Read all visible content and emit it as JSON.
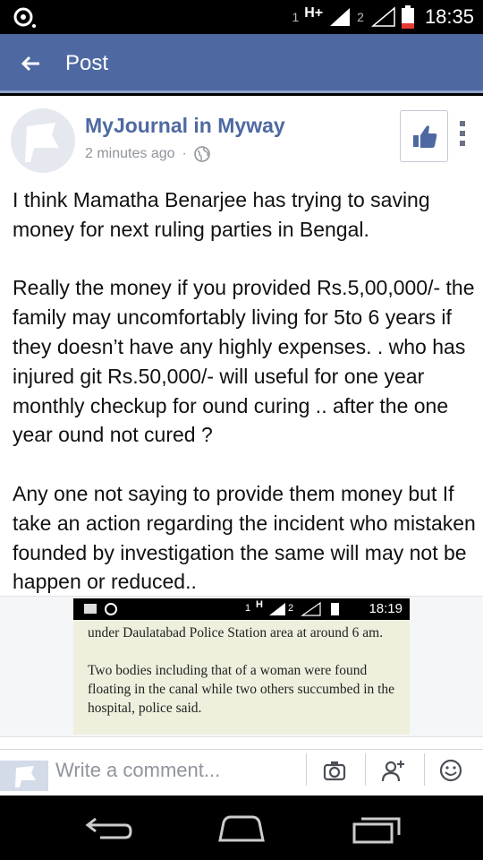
{
  "status_bar": {
    "sim1": "1",
    "network_type": "H+",
    "sim2": "2",
    "time": "18:35"
  },
  "app_bar": {
    "title": "Post"
  },
  "post": {
    "author": "MyJournal in Myway",
    "timestamp": "2 minutes ago",
    "separator": "·",
    "privacy_icon": "globe-icon",
    "paragraphs": [
      "I think Mamatha Benarjee has trying to saving money for next ruling parties in Bengal.",
      "Really the money if you provided Rs.5,00,000/- the family may uncomfortably living for 5to 6 years if they doesn’t have any highly expenses. . who has injured git Rs.50,000/- will useful for one year monthly checkup for ound curing .. after the one year ound not cured ?",
      "Any one not saying to provide them money but If take an action regarding the incident who mistaken founded by investigation the same will may not be happen or reduced.."
    ]
  },
  "shared_image": {
    "status_sim": "1",
    "status_network": "H",
    "status_sim2": "2",
    "status_time": "18:19",
    "paragraphs": [
      "under Daulatabad Police Station area at around 6 am.",
      "Two bodies including that of a woman were found floating in the canal while two others succumbed in the hospital, police said."
    ]
  },
  "comment_bar": {
    "placeholder": "Write a comment..."
  },
  "colors": {
    "brand": "#4e69a2",
    "meta_text": "#90949c"
  }
}
